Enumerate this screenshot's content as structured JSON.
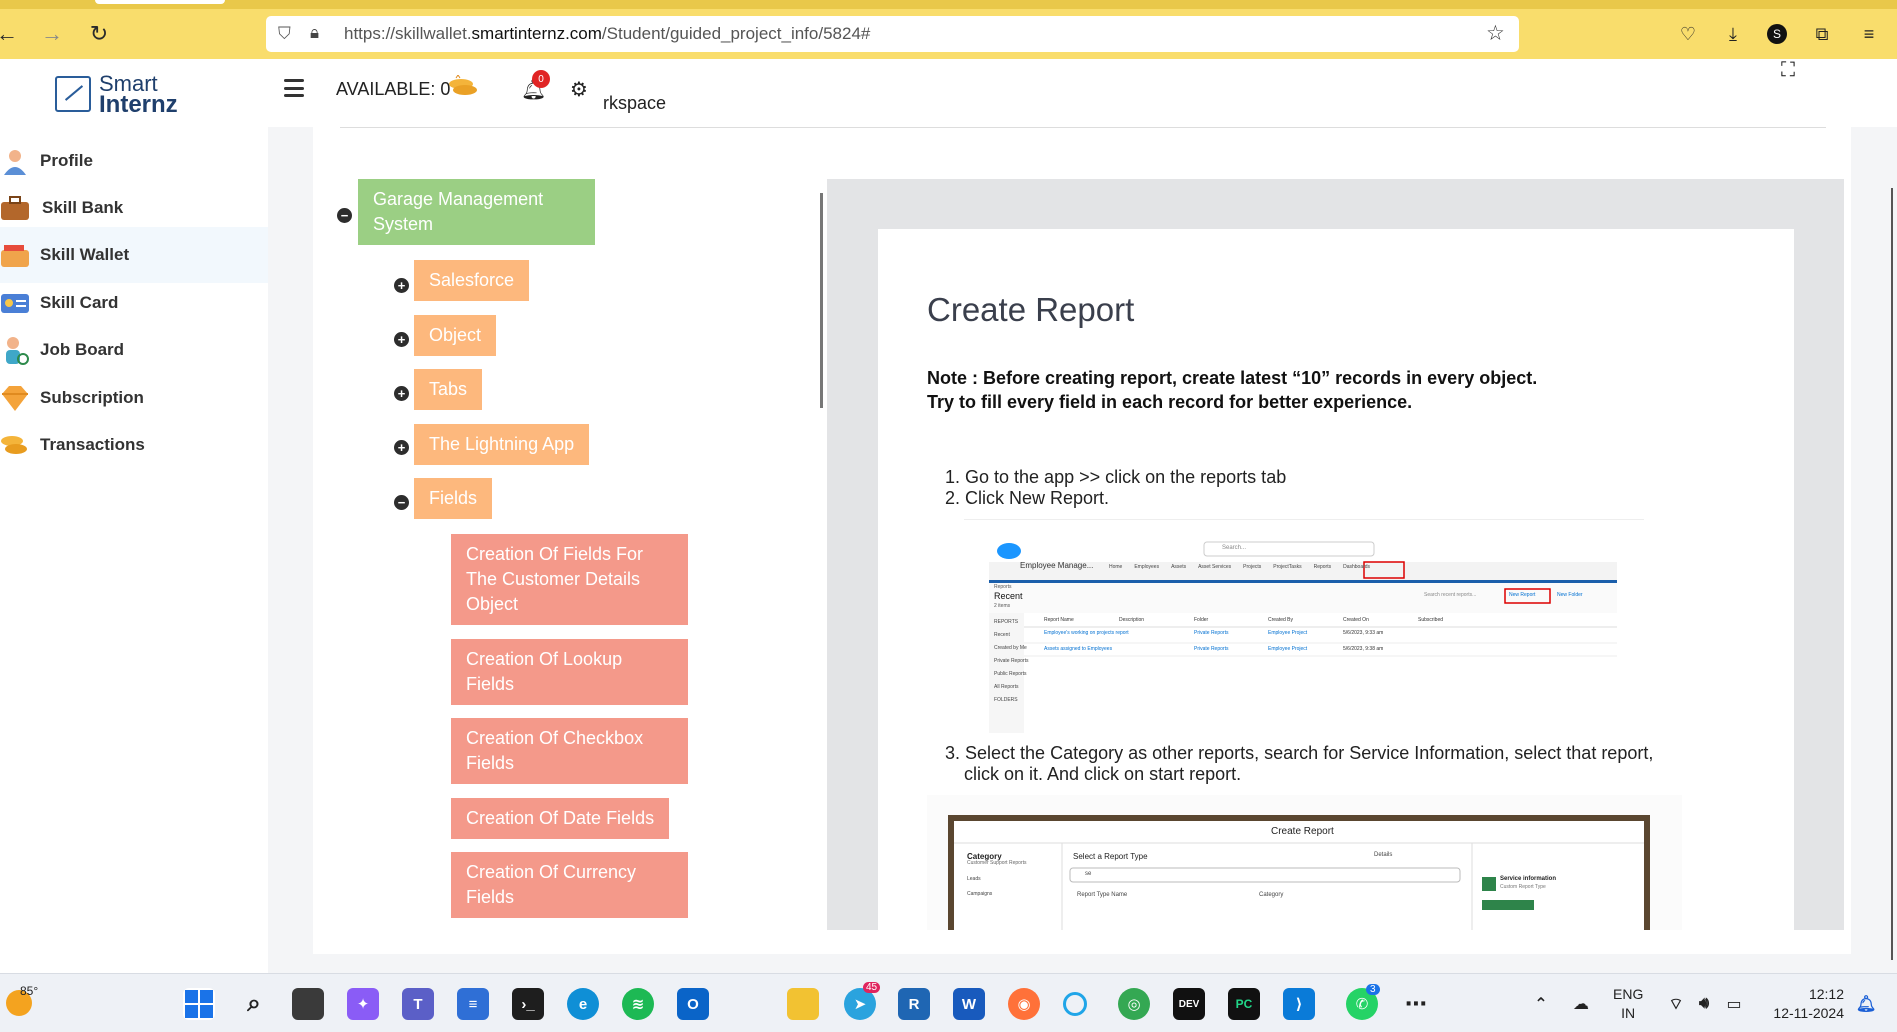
{
  "browser": {
    "url_prefix": "https://skillwallet.",
    "url_domain": "smartinternz.com",
    "url_path": "/Student/guided_project_info/5824#"
  },
  "logo": {
    "line1": "Smart",
    "line2": "Internz"
  },
  "sidebar": {
    "items": [
      {
        "label": "Profile",
        "icon": "user-icon"
      },
      {
        "label": "Skill Bank",
        "icon": "briefcase-icon"
      },
      {
        "label": "Skill Wallet",
        "icon": "wallet-icon",
        "active": true
      },
      {
        "label": "Skill Card",
        "icon": "id-card-icon"
      },
      {
        "label": "Job Board",
        "icon": "person-icon"
      },
      {
        "label": "Subscription",
        "icon": "diamond-icon"
      },
      {
        "label": "Transactions",
        "icon": "coins-icon"
      }
    ]
  },
  "header": {
    "available_label": "AVAILABLE: 0",
    "notification_count": "0",
    "workspace_label": "rkspace"
  },
  "tree": {
    "root": "Garage Management System",
    "level1": [
      "Salesforce",
      "Object",
      "Tabs",
      "The Lightning App",
      "Fields"
    ],
    "fields_children": [
      "Creation Of Fields For The Customer Details Object",
      "Creation Of Lookup Fields",
      "Creation Of Checkbox Fields",
      "Creation Of Date Fields",
      "Creation Of Currency Fields"
    ]
  },
  "doc": {
    "title": "Create Report",
    "note_line1": "Note : Before creating report, create latest “10” records in every object.",
    "note_line2": "Try to fill every field in each record for better experience.",
    "step1": "1. Go to the app  >>  click on the reports tab",
    "step2": "2. Click New Report.",
    "step3_line1": "3. Select the Category as other reports, search for Service Information, select that report,",
    "step3_line2": "click on it. And click on start report.",
    "shot1": {
      "app_name": "Employee Manage...",
      "nav": [
        "Home",
        "Employees",
        "Assets",
        "Asset Services",
        "Projects",
        "ProjectTasks",
        "Reports",
        "Dashboards"
      ],
      "search_placeholder": "Search...",
      "section": "Reports",
      "heading": "Recent",
      "count": "2 items",
      "search_reports": "Search recent reports...",
      "new_report": "New Report",
      "new_folder": "New Folder",
      "left_menu": [
        "REPORTS",
        "Recent",
        "Created by Me",
        "Private Reports",
        "Public Reports",
        "All Reports",
        "FOLDERS"
      ],
      "columns": [
        "Report Name",
        "Description",
        "Folder",
        "Created By",
        "Created On",
        "Subscribed"
      ],
      "rows": [
        [
          "Employee's working on projects report",
          "",
          "Private Reports",
          "Employee Project",
          "5/6/2023, 9:33 am"
        ],
        [
          "Assets assigned to Employees",
          "",
          "Private Reports",
          "Employee Project",
          "5/6/2023, 9:38 am"
        ]
      ]
    },
    "shot2": {
      "dialog_title": "Create Report",
      "category_label": "Category",
      "category_value": "Customer Support Reports",
      "left_list": [
        "Leads",
        "Campaigns"
      ],
      "select_type": "Select a Report Type",
      "search_value": "se",
      "col_name": "Report Type Name",
      "col_category": "Category",
      "details": "Details",
      "service_title": "Service information",
      "service_sub": "Custom Report Type"
    }
  },
  "taskbar": {
    "temp": "85°",
    "telegram_badge": "45",
    "whatsapp_badge": "3",
    "lang_line1": "ENG",
    "lang_line2": "IN",
    "time": "12:12",
    "date": "12-11-2024"
  },
  "colors": {
    "browser_bar": "#f9dd6c",
    "tree_root": "#9bcf84",
    "tree_level1": "#fdb87d",
    "tree_level2": "#f4998a",
    "badge": "#e02424"
  }
}
